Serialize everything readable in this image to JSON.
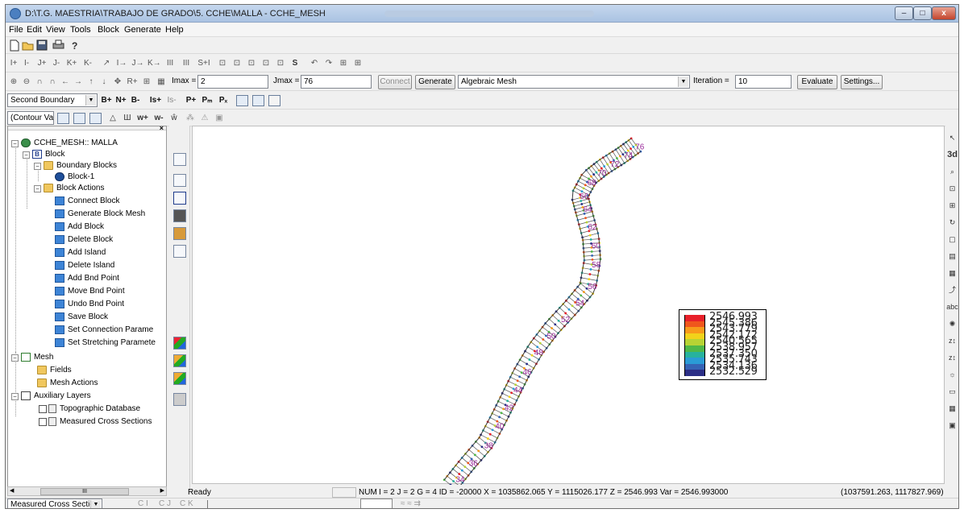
{
  "window": {
    "title": "D:\\T.G. MAESTRIA\\TRABAJO DE GRADO\\5. CCHE\\MALLA - CCHE_MESH",
    "controls": {
      "minimize": "–",
      "maximize": "□",
      "close": "x"
    }
  },
  "menu": [
    "File",
    "Edit",
    "View",
    "Tools",
    "Block",
    "Generate",
    "Help"
  ],
  "toolbar1": {
    "icons": [
      "new-icon",
      "open-icon",
      "save-icon",
      "print-icon",
      "help-icon"
    ]
  },
  "toolbar2": {
    "glyphs": [
      "I+",
      "I-",
      "J+",
      "J-",
      "K+",
      "K-",
      "↗",
      "I→",
      "J→",
      "K→",
      "III",
      "III",
      "S+I",
      "⊡",
      "⊡",
      "⊡",
      "⊡",
      "⊡",
      "S",
      "↶",
      "↷",
      "⊞",
      "⊞"
    ]
  },
  "toolbar3": {
    "imax_label": "Imax =",
    "imax_value": "2",
    "jmax_label": "Jmax =",
    "jmax_value": "76",
    "connect_label": "Connect",
    "generate_label": "Generate",
    "mesh_method": "Algebraic Mesh",
    "iteration_label": "Iteration =",
    "iteration_value": "10",
    "evaluate_label": "Evaluate",
    "settings_label": "Settings..."
  },
  "toolbar4": {
    "boundary_select": "Second Boundary",
    "buttons": [
      "B+",
      "N+",
      "B-",
      "Is+",
      "Is-",
      "P+",
      "Pₘ",
      "Pₓ"
    ]
  },
  "toolbar5": {
    "contour_select": "(Contour Valu"
  },
  "tree": {
    "root": "CCHE_MESH:: MALLA",
    "block": "Block",
    "boundary_blocks": "Boundary Blocks",
    "block1": "Block-1",
    "block_actions": "Block Actions",
    "actions": [
      "Connect Block",
      "Generate Block Mesh",
      "Add Block",
      "Delete Block",
      "Add Island",
      "Delete Island",
      "Add Bnd Point",
      "Move Bnd Point",
      "Undo Bnd Point",
      "Save Block",
      "Set Connection Parame",
      "Set Stretching Paramete"
    ],
    "mesh": "Mesh",
    "fields": "Fields",
    "mesh_actions": "Mesh Actions",
    "aux": "Auxiliary Layers",
    "topo": "Topographic Database",
    "measured": "Measured Cross Sections"
  },
  "legend": {
    "values": [
      "2546.993",
      "2545.386",
      "2543.779",
      "2542.172",
      "2540.565",
      "2538.957",
      "2537.350",
      "2535.743",
      "2534.136",
      "2532.529"
    ],
    "colors": [
      "#e8202a",
      "#f0561c",
      "#f89a1a",
      "#f2d21a",
      "#b7d334",
      "#4fb848",
      "#27b29e",
      "#2a9bd6",
      "#3563b5",
      "#2b2e86"
    ]
  },
  "mesh_labels": [
    "76",
    "74",
    "72",
    "70",
    "68",
    "66",
    "64",
    "62",
    "60",
    "58",
    "56",
    "54",
    "52",
    "50",
    "48",
    "46",
    "44",
    "42",
    "40",
    "38",
    "36",
    "34"
  ],
  "status": {
    "ready": "Ready",
    "num": "NUM",
    "info": "I = 2  J = 2  G = 4  ID = -20000  X = 1035862.065  Y = 1115026.177  Z = 2546.993  Var = 2546.993000",
    "coords": "(1037591.263, 1117827.969)"
  },
  "bottom": {
    "layer_select": "Measured Cross Sectic",
    "radios": [
      "C I",
      "C J",
      "C K"
    ]
  },
  "right_toolbar": [
    "pointer-icon",
    "3d-view-icon",
    "zoom-icon",
    "zoom-box-icon",
    "fit-icon",
    "rotate-icon",
    "frame-icon",
    "color-map-icon",
    "grid-icon",
    "plot-icon",
    "label-icon",
    "light-icon",
    "z-up-icon",
    "z-down-icon",
    "sun-icon",
    "cube-icon",
    "texture-icon",
    "screen-icon"
  ]
}
